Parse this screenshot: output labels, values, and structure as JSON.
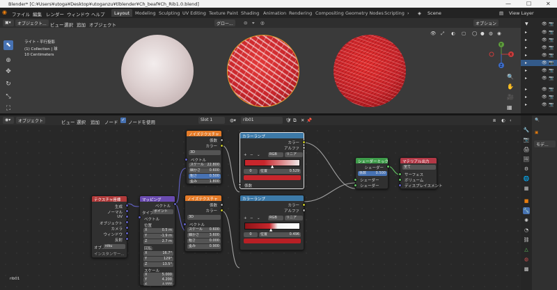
{
  "window": {
    "title": "Blender* [C:¥Users¥utoga¥Desktop¥utoganzu¥tlblender¥Ch_beaf¥Ch_Rib1.0.blend]"
  },
  "menu": {
    "items": [
      "ファイル",
      "編集",
      "レンダー",
      "ウィンドウ",
      "ヘルプ"
    ],
    "workspaces": [
      "Layout",
      "Modeling",
      "Sculpting",
      "UV Editing",
      "Texture Paint",
      "Shading",
      "Animation",
      "Rendering",
      "Compositing",
      "Geometry Nodes",
      "Scripting"
    ],
    "active_workspace": "Layout",
    "scene": "Scene",
    "view_layer": "View Layer"
  },
  "viewport": {
    "mode": "オブジェクト...",
    "menus": [
      "ビュー",
      "選択",
      "追加",
      "オブジェクト"
    ],
    "transform": "グロー...",
    "options": "オプション",
    "info_line1": "ライト・平行投影",
    "info_line2": "(1) Collection | 球",
    "info_line3": "10 Centimeters"
  },
  "gizmo": {
    "x": "X",
    "y": "Y",
    "z": "Z"
  },
  "node_editor": {
    "editor_mode": "オブジェクト",
    "menus": [
      "ビュー",
      "選択",
      "追加",
      "ノード"
    ],
    "use_nodes_label": "ノードを使用",
    "slot": "Slot 1",
    "material": "rib01",
    "material_footer": "rib01"
  },
  "nodes": {
    "texcoord": {
      "title": "テクスチャ座標",
      "outputs": [
        "生成",
        "ノーマル",
        "UV",
        "オブジェクト",
        "カメラ",
        "ウィンドウ",
        "反射"
      ],
      "object_label": "オブ...",
      "object_value": "niku",
      "instancer": "インスタンサー..."
    },
    "mapping": {
      "title": "マッピング",
      "output": "ベクトル",
      "type_label": "タイプ",
      "type_value": "ポイント",
      "vector": "ベクトル",
      "location": "位置",
      "loc": [
        [
          "X",
          "0.5 m"
        ],
        [
          "Y",
          "-1.9 m"
        ],
        [
          "Z",
          "2.7 m"
        ]
      ],
      "rotation": "回転:",
      "rot": [
        [
          "X",
          "16.7°"
        ],
        [
          "Y",
          "129°"
        ],
        [
          "Z",
          "13.5°"
        ]
      ],
      "scale": "スケール",
      "scl": [
        [
          "X",
          "5.000"
        ],
        [
          "Y",
          "4.200"
        ],
        [
          "Z",
          "1.000"
        ]
      ]
    },
    "noise1": {
      "title": "ノイズテクスチャ",
      "out_fac": "係数",
      "out_color": "カラー",
      "dim": "3D",
      "vector": "ベクトル",
      "fields": [
        [
          "スケール",
          "22.800"
        ],
        [
          "細かさ",
          "0.600"
        ],
        [
          "粗さ",
          "0.500"
        ],
        [
          "歪み",
          "1.800"
        ]
      ]
    },
    "noise2": {
      "title": "ノイズテクスチャ",
      "out_fac": "係数",
      "out_color": "カラー",
      "dim": "3D",
      "vector": "ベクトル",
      "fields": [
        [
          "スケール",
          "0.600"
        ],
        [
          "細かさ",
          "3.600"
        ],
        [
          "粗さ",
          "0.000"
        ],
        [
          "歪み",
          "0.900"
        ]
      ]
    },
    "ramp1": {
      "title": "カラーランプ",
      "out_color": "カラー",
      "out_alpha": "アルファ",
      "mode": "RGB",
      "interp": "リニア",
      "index": "0",
      "pos_label": "位置",
      "pos_value": "0.529",
      "input": "係数"
    },
    "ramp2": {
      "title": "カラーランプ",
      "out_color": "カラー",
      "out_alpha": "アルファ",
      "mode": "RGB",
      "interp": "リニア",
      "index": "0",
      "pos_label": "位置",
      "pos_value": "0.496",
      "input": "係数"
    },
    "mix": {
      "title": "シェーダーミックス",
      "output": "シェーダー",
      "fac_label": "係数",
      "fac_value": "0.500",
      "in1": "シェーダー",
      "in2": "シェーダー"
    },
    "output": {
      "title": "マテリアル出力",
      "target": "全て",
      "inputs": [
        "サーフェス",
        "ボリューム",
        "ディスプレイスメント"
      ]
    }
  },
  "properties": {
    "label": "モデ..."
  },
  "colors": {
    "accent": "#4772b3",
    "texture_header": "#e47b28",
    "converter_header": "#3d7aa8",
    "vector_header": "#6a4bb0",
    "input_header": "#b13a3a",
    "shader_header": "#3e9c4a",
    "output_header": "#b23846",
    "meat_red": "#c8262c"
  }
}
